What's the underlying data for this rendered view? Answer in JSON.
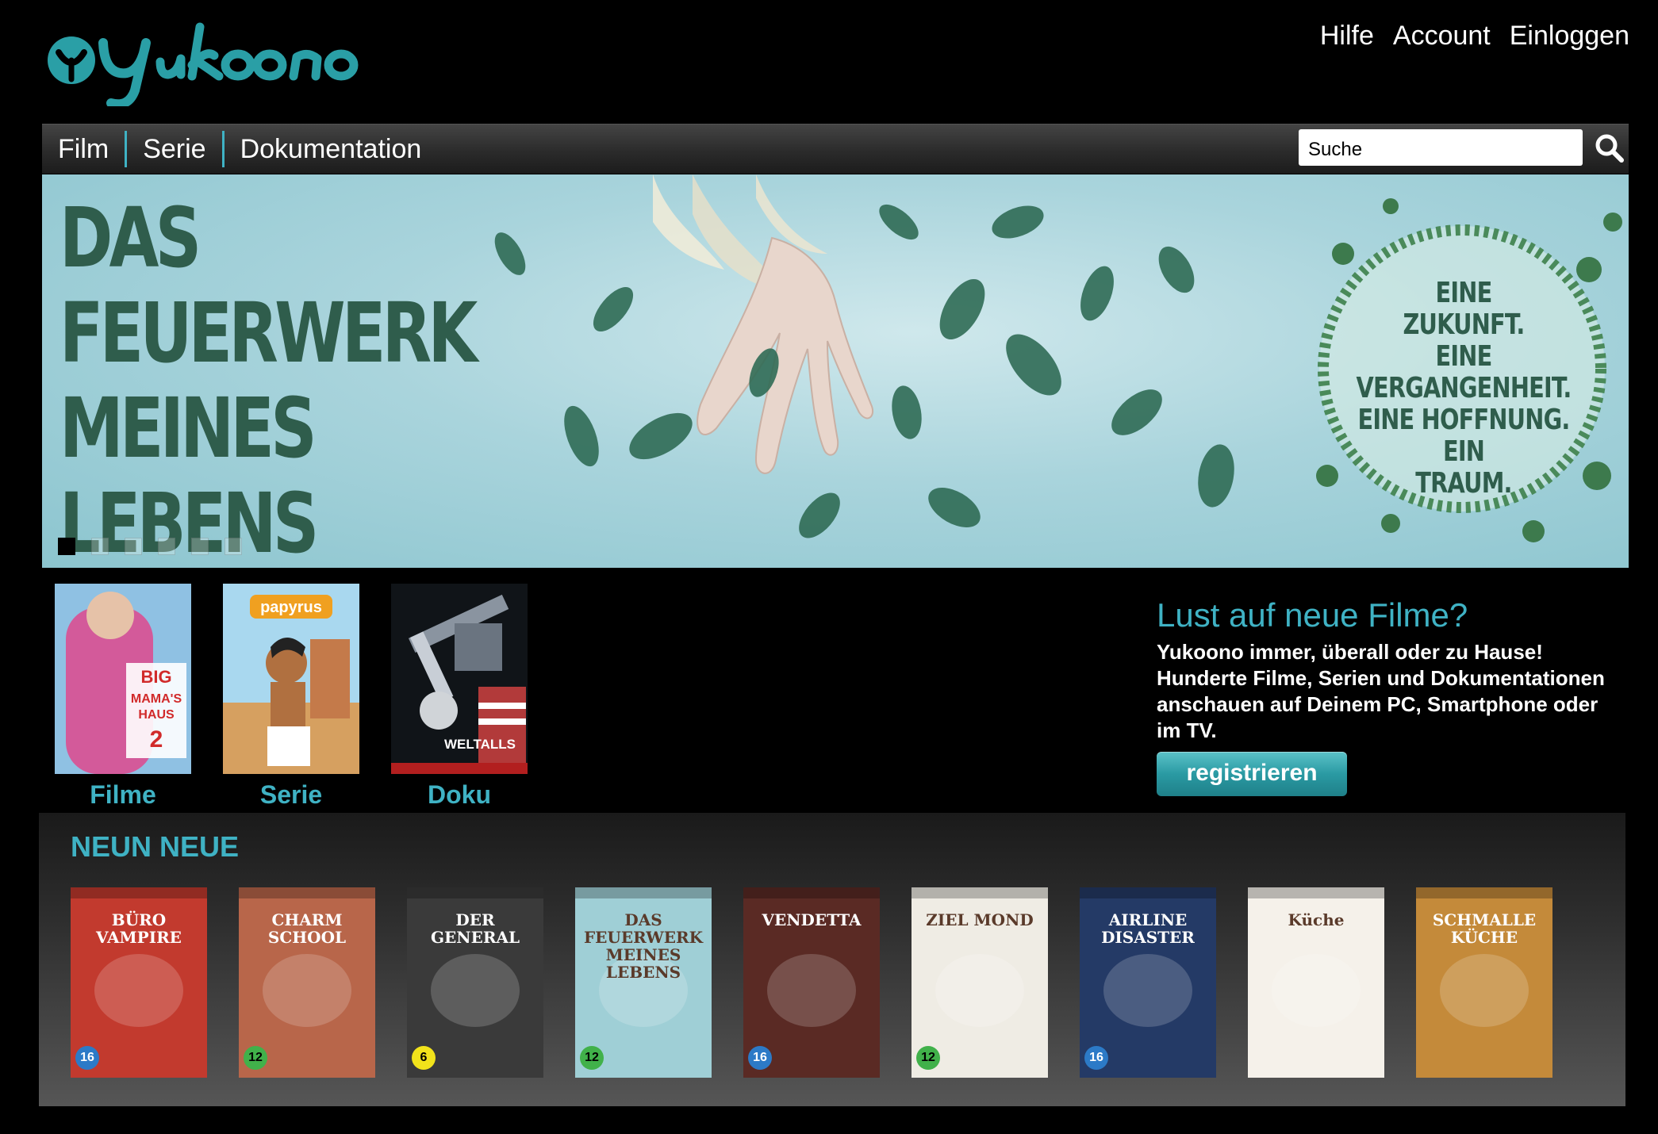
{
  "header": {
    "logo_text": "Yukoono",
    "links": [
      "Hilfe",
      "Account",
      "Einloggen"
    ]
  },
  "nav": {
    "items": [
      "Film",
      "Serie",
      "Dokumentation"
    ],
    "search_placeholder": "Suche"
  },
  "banner": {
    "title_lines": [
      "DAS",
      "FEUERWERK",
      "MEINES",
      "LEBENS"
    ],
    "tagline_lines": [
      "EINE",
      "ZUKUNFT.",
      "EINE",
      "VERGANGENHEIT.",
      "EINE HOFFNUNG.",
      "EIN",
      "TRAUM."
    ],
    "slide_count": 6,
    "active_slide": 1
  },
  "categories": [
    {
      "label": "Filme",
      "cover_text": "BIG MAMA'S HAUS 2"
    },
    {
      "label": "Serie",
      "cover_text": "papyrus"
    },
    {
      "label": "Doku",
      "cover_text": "WELTALLS"
    }
  ],
  "promo": {
    "title": "Lust auf neue Filme?",
    "text": "Yukoono immer, überall oder zu Hause! Hunderte Filme, Serien und Dokumentationen anschauen auf Deinem PC, Smartphone oder im TV.",
    "button_label": "registrieren"
  },
  "new_releases": {
    "title": "NEUN NEUE",
    "items": [
      {
        "cover_text": "BÜRO VAMPIRE",
        "age": "16",
        "age_class": "fsk-16",
        "bg": "#c23a2e"
      },
      {
        "cover_text": "CHARM SCHOOL",
        "age": "12",
        "age_class": "fsk-12",
        "bg": "#b8664a"
      },
      {
        "cover_text": "DER GENERAL",
        "age": "6",
        "age_class": "fsk-6",
        "bg": "#3a3a3a"
      },
      {
        "cover_text": "DAS FEUERWERK MEINES LEBENS",
        "age": "12",
        "age_class": "fsk-12",
        "bg": "#9fcfd6"
      },
      {
        "cover_text": "VENDETTA",
        "age": "16",
        "age_class": "fsk-16",
        "bg": "#5a2a24"
      },
      {
        "cover_text": "ZIEL MOND",
        "age": "12",
        "age_class": "fsk-12",
        "bg": "#efece4"
      },
      {
        "cover_text": "AIRLINE DISASTER",
        "age": "16",
        "age_class": "fsk-16",
        "bg": "#243a66"
      },
      {
        "cover_text": "Küche",
        "age": "",
        "age_class": "fsk-0",
        "bg": "#f5f1ea"
      },
      {
        "cover_text": "SCHMALLE KÜCHE",
        "age": "",
        "age_class": "fsk-0",
        "bg": "#c48a3a"
      }
    ]
  },
  "colors": {
    "accent": "#3fb2c4",
    "banner_text": "#2f5d4c"
  }
}
